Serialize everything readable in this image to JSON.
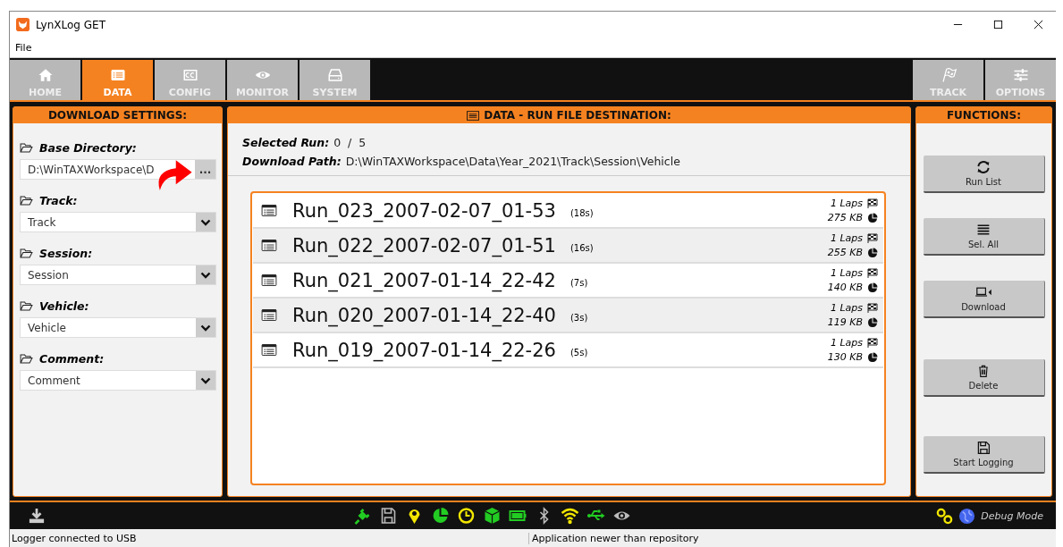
{
  "window": {
    "title": "LynXLog GET"
  },
  "menu": [
    "File"
  ],
  "tabs": [
    {
      "label": "HOME",
      "kind": "home",
      "selected": false
    },
    {
      "label": "DATA",
      "kind": "data",
      "selected": true
    },
    {
      "label": "CONFIG",
      "kind": "cc",
      "selected": false
    },
    {
      "label": "MONITOR",
      "kind": "eye",
      "selected": false
    },
    {
      "label": "SYSTEM",
      "kind": "drive",
      "selected": false
    }
  ],
  "right_tabs": [
    {
      "label": "TRACK",
      "kind": "flag",
      "selected": false
    },
    {
      "label": "OPTIONS",
      "kind": "sliders",
      "selected": false
    }
  ],
  "download_settings": {
    "title": "DOWNLOAD SETTINGS:",
    "fields": [
      {
        "label": "Base Directory:",
        "kind": "browse",
        "value": "D:\\WinTAXWorkspace\\D",
        "button": "..."
      },
      {
        "label": "Track:",
        "kind": "dropdown",
        "value": "Track"
      },
      {
        "label": "Session:",
        "kind": "dropdown",
        "value": "Session"
      },
      {
        "label": "Vehicle:",
        "kind": "dropdown",
        "value": "Vehicle"
      },
      {
        "label": "Comment:",
        "kind": "dropdown",
        "value": "Comment"
      }
    ]
  },
  "destination": {
    "title": "DATA - RUN FILE DESTINATION:",
    "selected_run_label": "Selected Run:",
    "selected_run": "0  /  5",
    "download_path_label": "Download Path:",
    "download_path": "D:\\WinTAXWorkspace\\Data\\Year_2021\\Track\\Session\\Vehicle",
    "runs": [
      {
        "name": "Run_023_2007-02-07_01-53",
        "duration": "(18s)",
        "laps": "1 Laps",
        "size": "275 KB"
      },
      {
        "name": "Run_022_2007-02-07_01-51",
        "duration": "(16s)",
        "laps": "1 Laps",
        "size": "255 KB"
      },
      {
        "name": "Run_021_2007-01-14_22-42",
        "duration": "(7s)",
        "laps": "1 Laps",
        "size": "140 KB"
      },
      {
        "name": "Run_020_2007-01-14_22-40",
        "duration": "(3s)",
        "laps": "1 Laps",
        "size": "119 KB"
      },
      {
        "name": "Run_019_2007-01-14_22-26",
        "duration": "(5s)",
        "laps": "1 Laps",
        "size": "130 KB"
      }
    ]
  },
  "functions": {
    "title": "FUNCTIONS:",
    "buttons": [
      {
        "label": "Run List",
        "kind": "refresh"
      },
      {
        "label": "Sel. All",
        "kind": "lines"
      },
      {
        "label": "Download",
        "kind": "laptop"
      },
      {
        "label": "Delete",
        "kind": "trash"
      },
      {
        "label": "Start Logging",
        "kind": "floppy"
      }
    ]
  },
  "status_icons": [
    {
      "kind": "plug",
      "color": "#22cc22"
    },
    {
      "kind": "floppy",
      "color": "#bbbbbb"
    },
    {
      "kind": "pin",
      "color": "#f2e600"
    },
    {
      "kind": "pie",
      "color": "#22cc22"
    },
    {
      "kind": "clock",
      "color": "#f2e600"
    },
    {
      "kind": "cube",
      "color": "#22cc22"
    },
    {
      "kind": "battery",
      "color": "#22cc22"
    },
    {
      "kind": "bluetooth",
      "color": "#bbbbbb"
    },
    {
      "kind": "wifi",
      "color": "#f2e600"
    },
    {
      "kind": "usb",
      "color": "#22cc22"
    },
    {
      "kind": "eye",
      "color": "#bbbbbb"
    }
  ],
  "debug_mode": "Debug Mode",
  "status_bar": [
    "Logger connected to USB",
    "Application newer than repository"
  ]
}
